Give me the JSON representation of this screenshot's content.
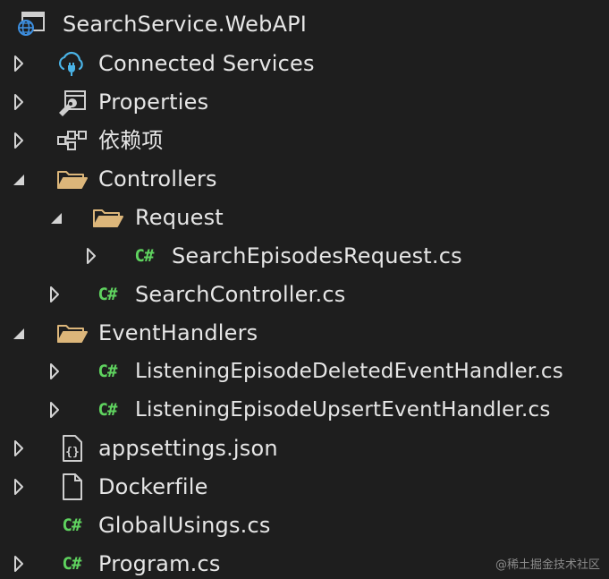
{
  "colors": {
    "background": "#1e1e1e",
    "text": "#e6e6e6",
    "folder": "#dcb67a",
    "csharp": "#5fd35f",
    "arrow": "#d4d4d4"
  },
  "project": {
    "label": "SearchService.WebAPI",
    "icon": "web-project-icon"
  },
  "items": [
    {
      "label": "Connected Services",
      "icon": "connected-services-icon",
      "expander": "collapsed"
    },
    {
      "label": "Properties",
      "icon": "properties-wrench-icon",
      "expander": "collapsed"
    },
    {
      "label": "依赖项",
      "icon": "dependencies-icon",
      "expander": "collapsed"
    },
    {
      "label": "Controllers",
      "icon": "folder-open-icon",
      "expander": "expanded"
    },
    {
      "label": "Request",
      "icon": "folder-open-icon",
      "expander": "expanded"
    },
    {
      "label": "SearchEpisodesRequest.cs",
      "icon": "csharp-file-icon",
      "expander": "collapsed"
    },
    {
      "label": "SearchController.cs",
      "icon": "csharp-file-icon",
      "expander": "collapsed"
    },
    {
      "label": "EventHandlers",
      "icon": "folder-open-icon",
      "expander": "expanded"
    },
    {
      "label": "ListeningEpisodeDeletedEventHandler.cs",
      "icon": "csharp-file-icon",
      "expander": "collapsed"
    },
    {
      "label": "ListeningEpisodeUpsertEventHandler.cs",
      "icon": "csharp-file-icon",
      "expander": "collapsed"
    },
    {
      "label": "appsettings.json",
      "icon": "json-file-icon",
      "expander": "collapsed"
    },
    {
      "label": "Dockerfile",
      "icon": "file-icon",
      "expander": "collapsed"
    },
    {
      "label": "GlobalUsings.cs",
      "icon": "csharp-file-icon",
      "expander": "none"
    },
    {
      "label": "Program.cs",
      "icon": "csharp-file-icon",
      "expander": "collapsed"
    }
  ],
  "csharp_glyph": "C#",
  "watermark": "@稀土掘金技术社区"
}
